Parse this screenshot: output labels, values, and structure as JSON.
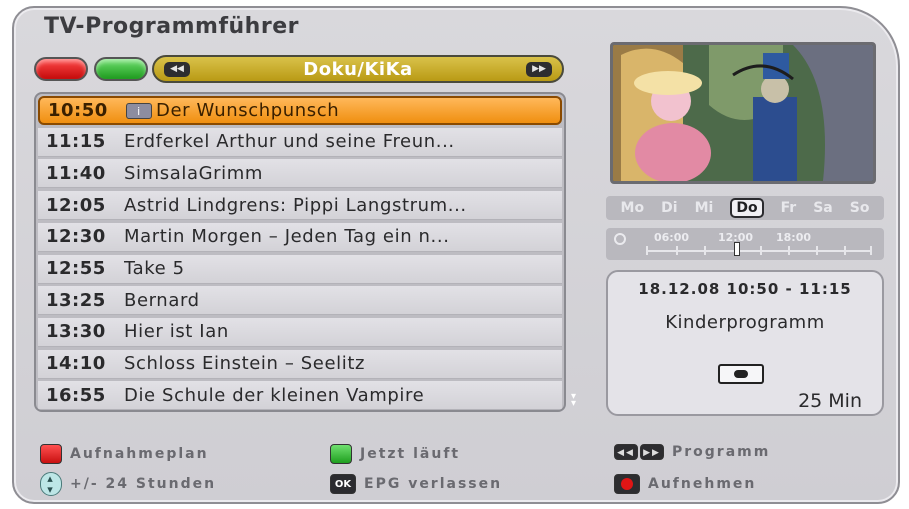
{
  "header": {
    "title": "TV-Programmführer"
  },
  "category": {
    "label": "Doku/KiKa",
    "prev_icon": "rewind-icon",
    "next_icon": "fast-forward-icon"
  },
  "programs": [
    {
      "time": "10:50",
      "title": "Der Wunschpunsch",
      "selected": true,
      "has_info_icon": true
    },
    {
      "time": "11:15",
      "title": "Erdferkel Arthur und seine Freun..."
    },
    {
      "time": "11:40",
      "title": "SimsalaGrimm"
    },
    {
      "time": "12:05",
      "title": "Astrid Lindgrens: Pippi Langstrum..."
    },
    {
      "time": "12:30",
      "title": "Martin Morgen – Jeden Tag ein n..."
    },
    {
      "time": "12:55",
      "title": "Take 5"
    },
    {
      "time": "13:25",
      "title": "Bernard"
    },
    {
      "time": "13:30",
      "title": "Hier ist Ian"
    },
    {
      "time": "14:10",
      "title": "Schloss Einstein – Seelitz"
    },
    {
      "time": "16:55",
      "title": "Die Schule der kleinen Vampire"
    }
  ],
  "weekdays": [
    "Mo",
    "Di",
    "Mi",
    "Do",
    "Fr",
    "Sa",
    "So"
  ],
  "active_weekday": "Do",
  "timeline": {
    "labels": [
      "06:00",
      "12:00",
      "18:00"
    ]
  },
  "info": {
    "datetime": "18.12.08 10:50 - 11:15",
    "category": "Kinderprogramm",
    "duration": "25 Min"
  },
  "legend": {
    "red": "Aufnahmeplan",
    "green": "Jetzt läuft",
    "nav": "Programm",
    "dpad": "+/- 24 Stunden",
    "ok_key": "OK",
    "ok": "EPG verlassen",
    "record": "Aufnehmen"
  },
  "colors": {
    "selected_row": "#f29a1e",
    "category_bar": "#c7ab2a",
    "red_key": "#d81e1e",
    "green_key": "#2faa2f"
  }
}
